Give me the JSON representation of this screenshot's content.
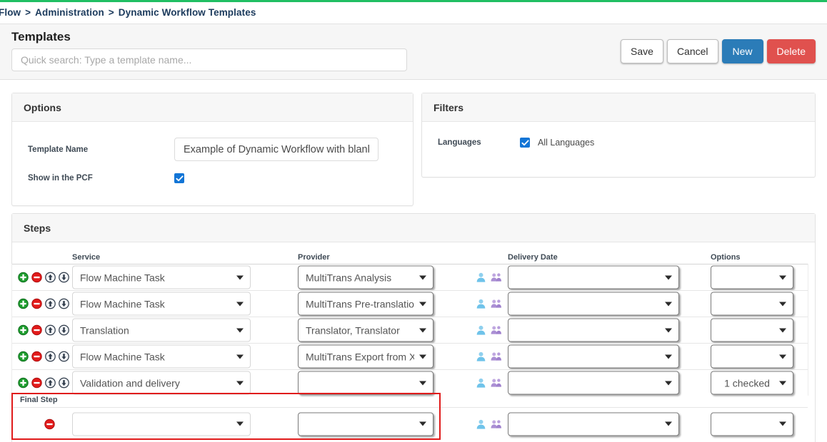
{
  "breadcrumb": {
    "items": [
      "Flow",
      "Administration",
      "Dynamic Workflow Templates"
    ],
    "separator": ">"
  },
  "header": {
    "title": "Templates",
    "search_placeholder": "Quick search: Type a template name...",
    "search_value": "",
    "buttons": [
      {
        "label": "Save",
        "style": "default"
      },
      {
        "label": "Cancel",
        "style": "default"
      },
      {
        "label": "New",
        "style": "primary"
      },
      {
        "label": "Delete",
        "style": "danger"
      }
    ]
  },
  "options_panel": {
    "title": "Options",
    "template_name_label": "Template Name",
    "template_name_value": "Example of Dynamic Workflow with blank",
    "show_in_pcf_label": "Show in the PCF",
    "show_in_pcf_checked": true
  },
  "filters_panel": {
    "title": "Filters",
    "languages_label": "Languages",
    "all_languages_label": "All Languages",
    "all_languages_checked": true
  },
  "steps_panel": {
    "title": "Steps",
    "columns": {
      "service": "Service",
      "provider": "Provider",
      "delivery_date": "Delivery Date",
      "options": "Options"
    },
    "row_actions": [
      "add-step",
      "remove-step",
      "move-step-up",
      "move-step-down"
    ],
    "people_icons": [
      "single-user-icon",
      "user-group-icon"
    ],
    "rows": [
      {
        "service": "Flow Machine Task",
        "provider": "MultiTrans Analysis",
        "delivery_date": "",
        "options": ""
      },
      {
        "service": "Flow Machine Task",
        "provider": "MultiTrans Pre-translation",
        "delivery_date": "",
        "options": ""
      },
      {
        "service": "Translation",
        "provider": "Translator, Translator",
        "delivery_date": "",
        "options": ""
      },
      {
        "service": "Flow Machine Task",
        "provider": "MultiTrans Export from XLI",
        "delivery_date": "",
        "options": ""
      },
      {
        "service": "Validation and delivery",
        "provider": "",
        "delivery_date": "",
        "options": "1 checked"
      }
    ],
    "final_step": {
      "label": "Final Step",
      "service": "",
      "provider": "",
      "delivery_date": "",
      "options": "",
      "highlight_color": "#e01b1b"
    }
  },
  "colors": {
    "accent_green": "#21bf63",
    "primary_blue": "#2b7cb8",
    "danger_red": "#e0514e",
    "checkbox_blue": "#1275d6",
    "add_green": "#1f9d2f",
    "remove_red": "#e21b1b",
    "highlight_red": "#e01b1b",
    "breadcrumb_text": "#1b3a5c"
  }
}
